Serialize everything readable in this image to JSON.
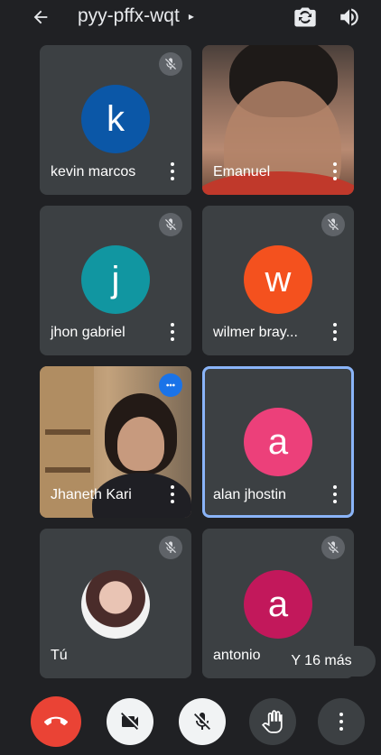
{
  "header": {
    "meeting_code": "pyy-pffx-wqt",
    "caret": "▸"
  },
  "tiles": [
    {
      "name": "kevin marcos",
      "initial": "k",
      "avatar_color": "#0b57a7"
    },
    {
      "name": "Emanuel"
    },
    {
      "name": "jhon gabriel",
      "initial": "j",
      "avatar_color": "#1196a1"
    },
    {
      "name": "wilmer bray...",
      "initial": "w",
      "avatar_color": "#f4511e"
    },
    {
      "name": "Jhaneth Kari"
    },
    {
      "name": "alan jhostin",
      "initial": "a",
      "avatar_color": "#ec407a"
    },
    {
      "name": "Tú"
    },
    {
      "name": "antonio",
      "initial": "a",
      "avatar_color": "#c2185b"
    }
  ],
  "more_participants": "Y 16 más",
  "colors": {
    "background": "#202124",
    "tile": "#3c4043",
    "end_call": "#ea4335",
    "highlight": "#8ab4f8"
  }
}
